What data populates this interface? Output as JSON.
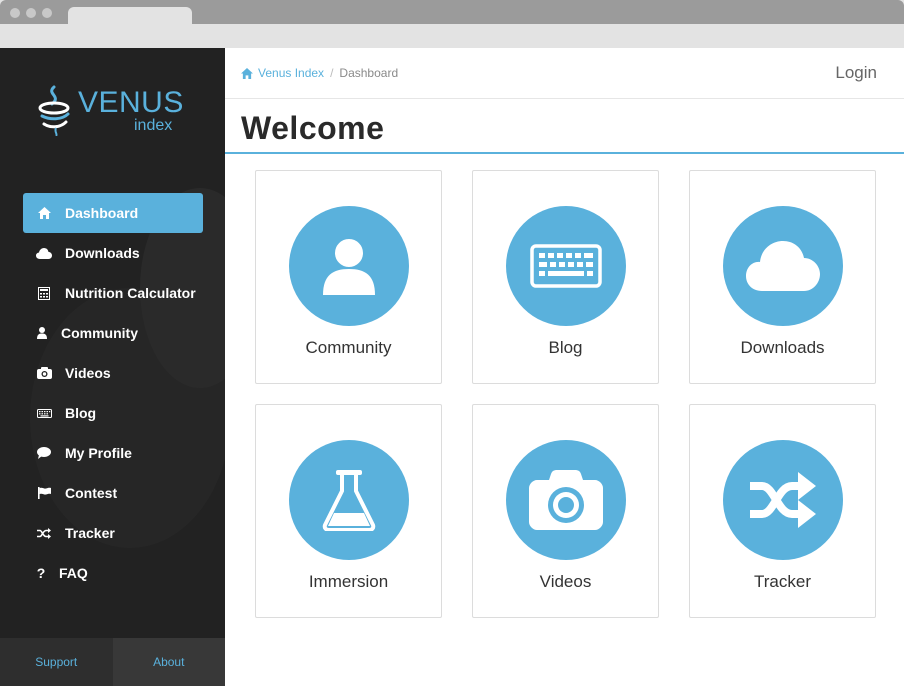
{
  "logo": {
    "brand": "VENUS",
    "sub": "index"
  },
  "sidebar": {
    "items": [
      {
        "label": "Dashboard",
        "icon": "home-icon",
        "active": true
      },
      {
        "label": "Downloads",
        "icon": "cloud-icon"
      },
      {
        "label": "Nutrition Calculator",
        "icon": "calculator-icon"
      },
      {
        "label": "Community",
        "icon": "user-icon"
      },
      {
        "label": "Videos",
        "icon": "camera-icon"
      },
      {
        "label": "Blog",
        "icon": "keyboard-icon"
      },
      {
        "label": "My Profile",
        "icon": "comment-icon"
      },
      {
        "label": "Contest",
        "icon": "flag-icon"
      },
      {
        "label": "Tracker",
        "icon": "shuffle-icon"
      },
      {
        "label": "FAQ",
        "icon": "question-icon"
      }
    ],
    "footer": {
      "support": "Support",
      "about": "About"
    }
  },
  "header": {
    "breadcrumb": {
      "home": "Venus Index",
      "separator": "/",
      "current": "Dashboard"
    },
    "login": "Login"
  },
  "main": {
    "title": "Welcome",
    "tiles": [
      {
        "label": "Community",
        "icon": "user-icon"
      },
      {
        "label": "Blog",
        "icon": "keyboard-icon"
      },
      {
        "label": "Downloads",
        "icon": "cloud-icon"
      },
      {
        "label": "Immersion",
        "icon": "flask-icon"
      },
      {
        "label": "Videos",
        "icon": "camera-icon"
      },
      {
        "label": "Tracker",
        "icon": "shuffle-icon"
      }
    ]
  },
  "colors": {
    "accent": "#5ab1dc",
    "sidebar": "#222222",
    "text": "#333333"
  }
}
